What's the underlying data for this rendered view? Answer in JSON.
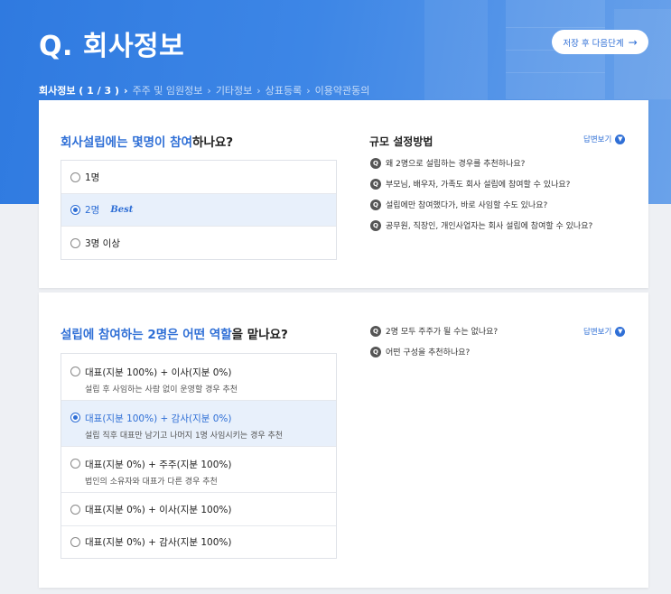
{
  "header": {
    "title": "Q. 회사정보",
    "save_button": "저장 후 다음단계",
    "breadcrumb": {
      "current": "회사정보 ( 1 / 3 )",
      "steps": [
        "주주 및 임원정보",
        "기타정보",
        "상표등록",
        "이용약관동의"
      ]
    }
  },
  "section1": {
    "question_prefix": "회사설립에는 몇명이 참여",
    "question_suffix": "하나요?",
    "options": [
      {
        "label": "1명"
      },
      {
        "label": "2명",
        "badge": "Best"
      },
      {
        "label": "3명 이상"
      }
    ],
    "selected_index": 1,
    "side_title": "규모 설정방법",
    "answer_link": "답변보기",
    "faq": [
      "왜 2명으로 설립하는 경우를 추천하나요?",
      "부모님, 배우자, 가족도 회사 설립에 참여할 수 있나요?",
      "설립에만 참여했다가, 바로 사임할 수도 있나요?",
      "공무원, 직장인, 개인사업자는 회사 설립에 참여할 수 있나요?"
    ]
  },
  "section2": {
    "question_prefix": "설립에 참여하는 2명은 어떤 역할",
    "question_suffix": "을 맡나요?",
    "options": [
      {
        "label": "대표(지분 100%) + 이사(지분 0%)",
        "desc": "설립 후 사임하는 사람 없이 운영할 경우 추천"
      },
      {
        "label": "대표(지분 100%) + 감사(지분 0%)",
        "desc": "설립 직후 대표만 남기고 나머지 1명 사임시키는 경우 추천"
      },
      {
        "label": "대표(지분 0%) + 주주(지분 100%)",
        "desc": "법인의 소유자와 대표가 다른 경우 추천"
      },
      {
        "label": "대표(지분 0%) + 이사(지분 100%)"
      },
      {
        "label": "대표(지분 0%) + 감사(지분 100%)"
      }
    ],
    "selected_index": 1,
    "answer_link": "답변보기",
    "faq": [
      "2명 모두 주주가 될 수는 없나요?",
      "어떤 구성을 추천하나요?"
    ]
  },
  "faq_badge": "Q",
  "colors": {
    "accent": "#2f6fd6",
    "hero": "#3d86e6"
  }
}
